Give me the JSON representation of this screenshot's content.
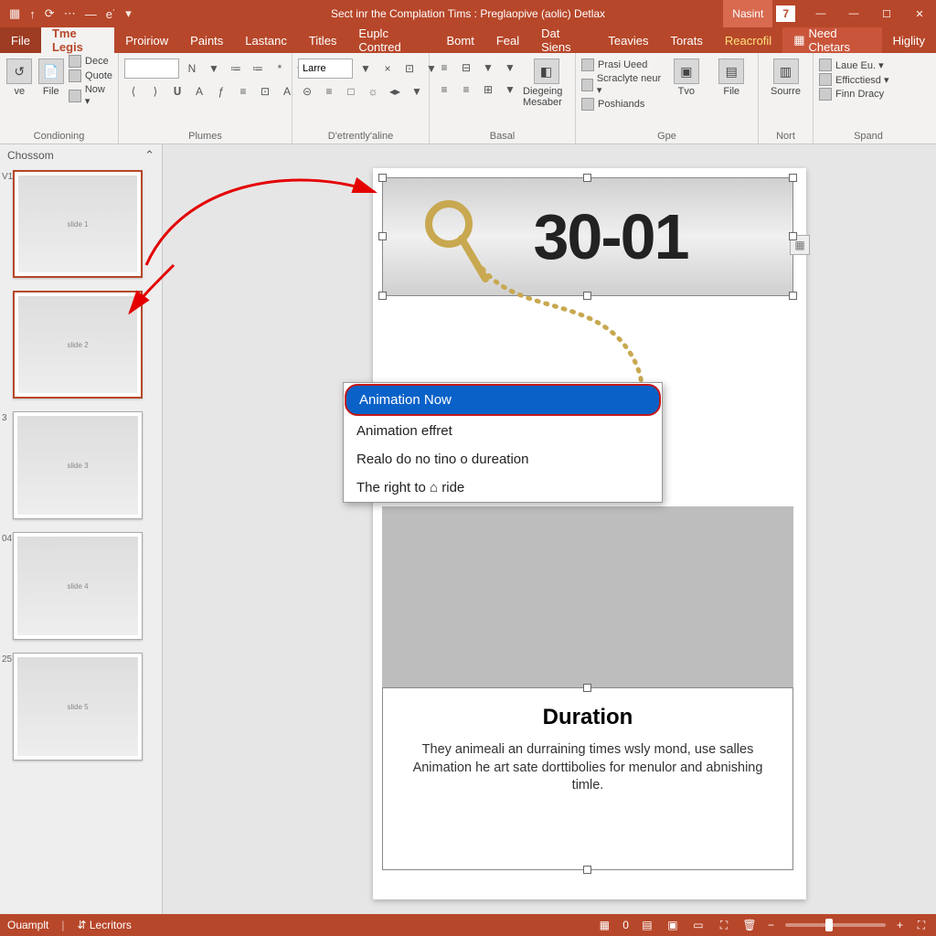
{
  "titlebar": {
    "title": "Sect inr the Complation Tims :  Preglaopive (aolic) Detlax",
    "user": "Nasint",
    "count": "7"
  },
  "tabs": {
    "file": "File",
    "list": [
      "Tme Legis",
      "Proiriow",
      "Paints",
      "Lastanc",
      "Titles",
      "Euplc Contred",
      "Bomt",
      "Feal",
      "Dat Siens",
      "Teavies",
      "Torats"
    ],
    "activeIndex": 0,
    "special": [
      "Reacrofil",
      "Need Chetars",
      "Higlity"
    ]
  },
  "ribbon": {
    "groups": [
      {
        "label": "Condioning",
        "big": [
          {
            "name": "ve",
            "icon": "↺"
          },
          {
            "name": "File",
            "icon": "📄"
          }
        ],
        "small": [
          "Dece",
          "Quote",
          "Now ▾"
        ]
      },
      {
        "label": "Plumes",
        "combo": "",
        "row1": [
          "N",
          "▼",
          "",
          "≔",
          "≔",
          "*",
          "↷"
        ],
        "row2": [
          "⟨",
          "⟩",
          "𝐔",
          "A",
          "ƒ",
          "≡",
          "⊡",
          "A"
        ]
      },
      {
        "label": "D'etrently'aline",
        "combo": "Larre",
        "row1": [
          "▼",
          "×",
          "⊡",
          "▼",
          "▼"
        ],
        "row2": [
          "⊝",
          "≡",
          "□",
          "☼",
          "◂▸",
          "▼"
        ]
      },
      {
        "label": "Basal",
        "row1": [
          "≡",
          "⊟",
          "▼",
          "▼"
        ],
        "row2": [
          "≡",
          "≡",
          "⊞",
          "▼"
        ],
        "big": [
          {
            "name": "Diegeing Mesaber",
            "icon": "◧"
          }
        ]
      },
      {
        "label": "Gpe",
        "small": [
          "Prasi Ueed",
          "Scraclyte neur ▾",
          "Poshiands"
        ],
        "big": [
          {
            "name": "Tvo",
            "icon": "▣"
          },
          {
            "name": "File",
            "icon": "▤"
          }
        ]
      },
      {
        "label": "Nort",
        "big": [
          {
            "name": "Sourre",
            "icon": "▥"
          }
        ]
      },
      {
        "label": "Spand",
        "small": [
          "Laue Eu. ▾",
          "Efficctiesd ▾",
          "Finn Dracy"
        ]
      }
    ]
  },
  "panel": {
    "header": "Chossom",
    "thumbs": [
      "V1",
      "",
      "3",
      "04",
      "25"
    ]
  },
  "slide": {
    "bigNumber": "30-01",
    "duration_heading": "Duration",
    "duration_body": "They animeali an durraining times wsly mond, use salles Animation he art sate dorttibolies for menulor and abnishing timle."
  },
  "ctxmenu": {
    "items": [
      "Animation Now",
      "Animation effret",
      "Realo do no tino o dureation",
      "The right to ⌂ ride"
    ],
    "selected": 0
  },
  "status": {
    "left1": "Ouamplt",
    "left2": "⇵ Lecritors",
    "page": "0",
    "object": "□"
  }
}
